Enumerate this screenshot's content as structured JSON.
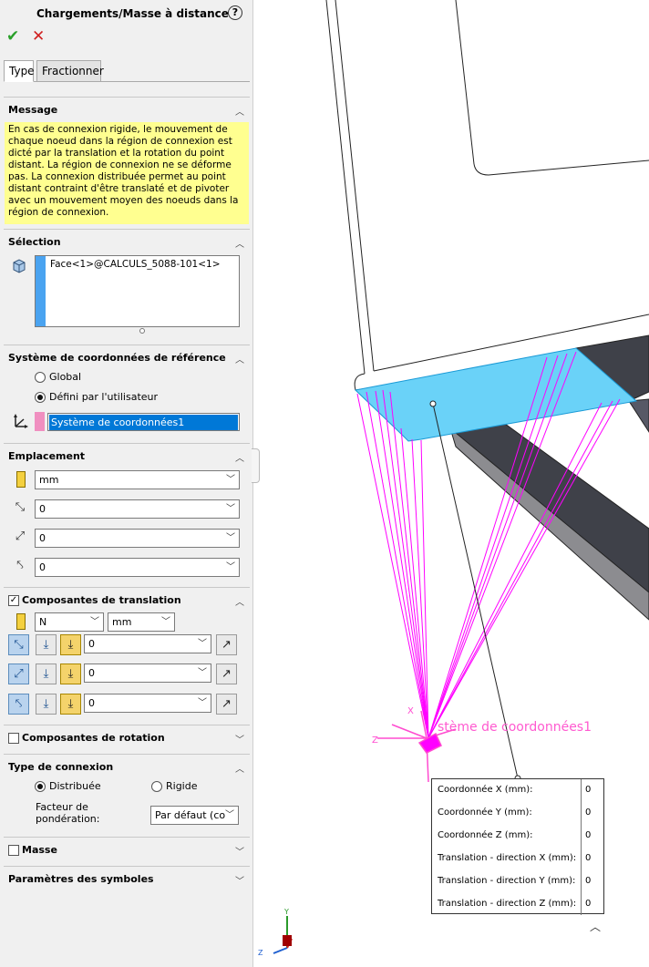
{
  "panel": {
    "title": "Chargements/Masse à distance",
    "help_glyph": "?",
    "ok_glyph": "✔",
    "cancel_glyph": "✕",
    "tabs": [
      {
        "label": "Type"
      },
      {
        "label": "Fractionner"
      }
    ],
    "message": {
      "header": "Message",
      "text": "En cas de connexion rigide, le mouvement de chaque noeud dans la région de connexion est dicté par la translation et la rotation du point distant. La région de connexion ne se déforme pas. La connexion distribuée permet au point distant contraint d'être translaté et de pivoter avec un mouvement moyen des noeuds dans la région de connexion."
    },
    "selection": {
      "header": "Sélection",
      "item": "Face<1>@CALCULS_5088-101<1>",
      "color": "#4aa3f0"
    },
    "coord_system": {
      "header": "Système de coordonnées de référence",
      "option_global": "Global",
      "option_user": "Défini par l'utilisateur",
      "selected": "Défini par l'utilisateur",
      "value": "Système de coordonnées1",
      "color": "#f08fc0"
    },
    "location": {
      "header": "Emplacement",
      "unit": "mm",
      "x": "0",
      "y": "0",
      "z": "0"
    },
    "translation": {
      "header": "Composantes de translation",
      "checked": true,
      "force_unit": "N",
      "length_unit": "mm",
      "x": "0",
      "y": "0",
      "z": "0"
    },
    "rotation": {
      "header": "Composantes de rotation",
      "checked": false
    },
    "connection": {
      "header": "Type de connexion",
      "option_distributed": "Distribuée",
      "option_rigid": "Rigide",
      "selected": "Distribuée",
      "weight_label_line1": "Facteur de",
      "weight_label_line2": "pondération:",
      "weight_value": "Par défaut (co"
    },
    "mass": {
      "header": "Masse",
      "checked": false
    },
    "symbols": {
      "header": "Paramètres des symboles"
    }
  },
  "viewport": {
    "cs_label": "stème de coordonnées1",
    "triad": {
      "x": "X",
      "y": "Y",
      "z": "Z"
    },
    "callout_rows": [
      {
        "label": "Coordonnée X (mm):",
        "value": "0"
      },
      {
        "label": "Coordonnée Y (mm):",
        "value": "0"
      },
      {
        "label": "Coordonnée Z (mm):",
        "value": "0"
      },
      {
        "label": "Translation -  direction X (mm):",
        "value": "0"
      },
      {
        "label": "Translation -  direction Y (mm):",
        "value": "0"
      },
      {
        "label": "Translation -  direction Z (mm):",
        "value": "0"
      }
    ],
    "colors": {
      "face_highlight": "#6ad2f8",
      "spider_lines": "#ff00ff",
      "beam": "#3f4149"
    }
  }
}
